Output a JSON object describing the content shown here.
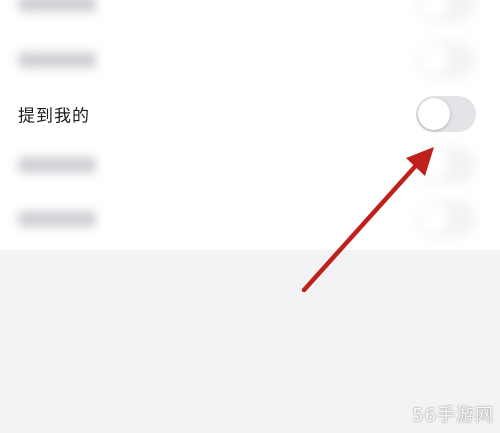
{
  "settings": {
    "rows": [
      {
        "label": "",
        "toggle_on": false
      },
      {
        "label": "",
        "toggle_on": false
      },
      {
        "label": "提到我的",
        "toggle_on": false
      },
      {
        "label": "",
        "toggle_on": false
      },
      {
        "label": "",
        "toggle_on": false
      }
    ]
  },
  "annotation": {
    "arrow_color": "#c0201b"
  },
  "watermark": {
    "text": "56手游网"
  },
  "colors": {
    "background": "#f3f3f6",
    "card": "#ffffff",
    "toggle_off": "#e6e6ea"
  }
}
